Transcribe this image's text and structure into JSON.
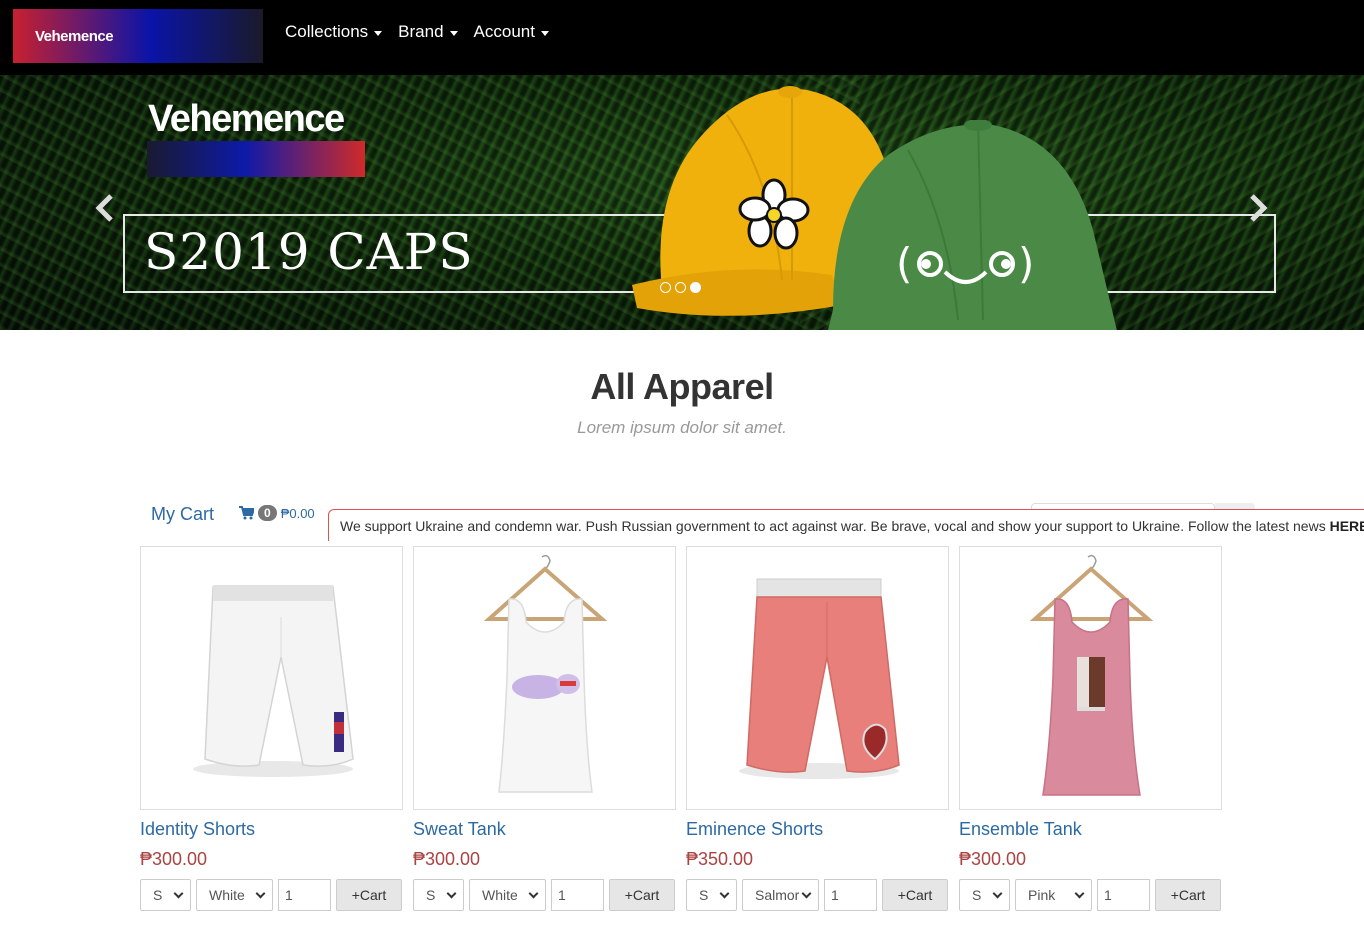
{
  "navbar": {
    "brand": "Vehemence",
    "menu": [
      {
        "label": "Collections"
      },
      {
        "label": "Brand"
      },
      {
        "label": "Account"
      }
    ]
  },
  "hero": {
    "brand": "Vehemence",
    "title": "S2019 CAPS",
    "prev_icon": "chevron-left-icon",
    "next_icon": "chevron-right-icon",
    "slides": 3,
    "active_slide": 3
  },
  "section": {
    "title": "All Apparel",
    "subtitle": "Lorem ipsum dolor sit amet."
  },
  "cart": {
    "label": "My Cart",
    "count": "0",
    "total": "₱0.00",
    "icon": "shopping-cart-icon"
  },
  "notice": {
    "text": "We support Ukraine and condemn war. Push Russian government to act against war. Be brave, vocal and show your support to Ukraine. Follow the latest news ",
    "link": "HERE"
  },
  "products": [
    {
      "name": "Identity Shorts",
      "price": "₱300.00",
      "size": "S",
      "color": "White",
      "qty": "1",
      "button": "+Cart"
    },
    {
      "name": "Sweat Tank",
      "price": "₱300.00",
      "size": "S",
      "color": "White",
      "qty": "1",
      "button": "+Cart"
    },
    {
      "name": "Eminence Shorts",
      "price": "₱350.00",
      "size": "S",
      "color": "Salmor",
      "qty": "1",
      "button": "+Cart"
    },
    {
      "name": "Ensemble Tank",
      "price": "₱300.00",
      "size": "S",
      "color": "Pink",
      "qty": "1",
      "button": "+Cart"
    }
  ],
  "colors": {
    "link": "#2d6aa3",
    "price": "#a94442",
    "notice_border": "#d9534f"
  }
}
